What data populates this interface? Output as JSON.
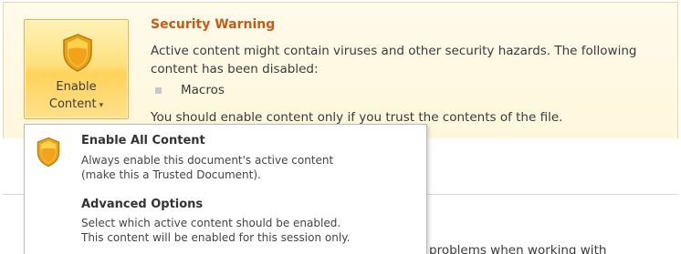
{
  "warning": {
    "title": "Security Warning",
    "line1": "Active content might contain viruses and other security hazards. The following",
    "line2": "content has been disabled:",
    "disabled_item": "Macros",
    "line3": "You should enable content only if you trust the contents of the file.",
    "background_partial_text": "problems when working with"
  },
  "enable_button": {
    "line1": "Enable",
    "line2": "Content",
    "caret": "▾"
  },
  "menu": {
    "items": [
      {
        "title": "Enable All Content",
        "desc1": "Always enable this document's active content",
        "desc2": "(make this a Trusted Document)."
      },
      {
        "title": "Advanced Options",
        "desc1": "Select which active content should be enabled.",
        "desc2": "This content will be enabled for this session only."
      }
    ]
  },
  "colors": {
    "title_accent": "#c45c16",
    "button_gold": "#ffe07e",
    "shield_gold": "#f4b21b"
  }
}
